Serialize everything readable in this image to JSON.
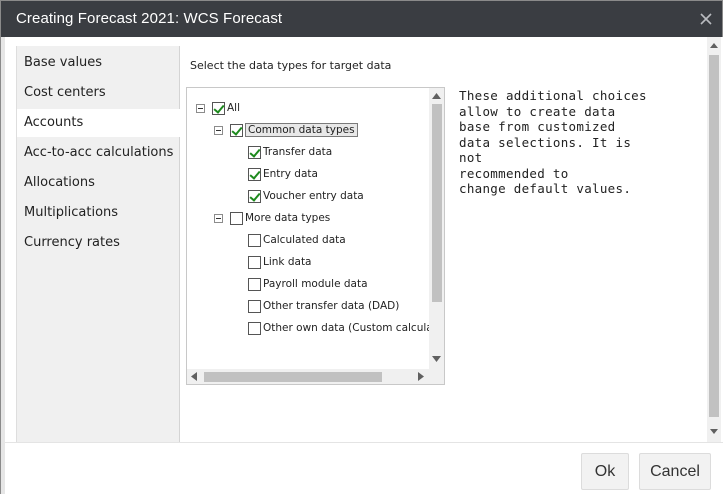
{
  "window": {
    "title": "Creating Forecast 2021: WCS Forecast"
  },
  "sidebar": {
    "items": [
      {
        "label": "Base values"
      },
      {
        "label": "Cost centers"
      },
      {
        "label": "Accounts"
      },
      {
        "label": "Acc-to-acc calculations"
      },
      {
        "label": "Allocations"
      },
      {
        "label": "Multiplications"
      },
      {
        "label": "Currency rates"
      }
    ],
    "active": "Accounts"
  },
  "content": {
    "instruction": "Select the data types for target data",
    "tree": {
      "all": {
        "label": "All",
        "checked": true
      },
      "common": {
        "label": "Common data types",
        "checked": true,
        "children": [
          {
            "label": "Transfer data",
            "checked": true
          },
          {
            "label": "Entry data",
            "checked": true
          },
          {
            "label": "Voucher entry data",
            "checked": true
          }
        ]
      },
      "more": {
        "label": "More data types",
        "checked": false,
        "children": [
          {
            "label": "Calculated data",
            "checked": false
          },
          {
            "label": "Link data",
            "checked": false
          },
          {
            "label": "Payroll module data",
            "checked": false
          },
          {
            "label": "Other transfer data (DAD)",
            "checked": false
          },
          {
            "label": "Other own data (Custom calculati",
            "checked": false
          }
        ]
      }
    },
    "note": "These additional choices\nallow to create data\nbase from customized\ndata selections. It is not\nrecommended to\nchange default values."
  },
  "footer": {
    "ok_label": "Ok",
    "cancel_label": "Cancel"
  },
  "colors": {
    "titlebar": "#3a3d42",
    "check": "#1d8a1d",
    "sidebar_bg": "#f0f0f0"
  },
  "icons": {
    "close": "close-icon",
    "expander": "minus-box-icon"
  }
}
